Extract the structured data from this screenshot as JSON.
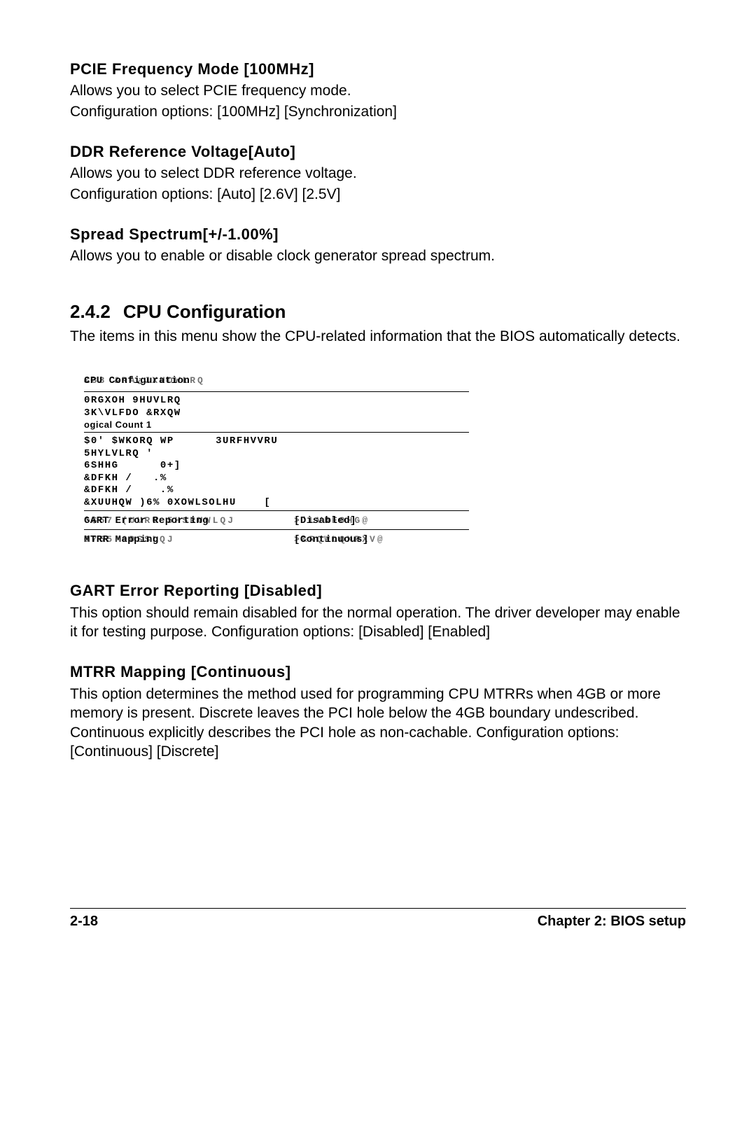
{
  "sections": [
    {
      "heading": "PCIE Frequency Mode [100MHz]",
      "lines": [
        "Allows you to select PCIE frequency mode.",
        "Configuration options: [100MHz] [Synchronization]"
      ]
    },
    {
      "heading": "DDR Reference Voltage[Auto]",
      "lines": [
        "Allows you to select DDR reference voltage.",
        "Configuration options: [Auto] [2.6V] [2.5V]"
      ]
    },
    {
      "heading": "Spread Spectrum[+/-1.00%]",
      "lines": [
        "Allows you to enable or disable clock generator spread spectrum."
      ]
    }
  ],
  "subsection": {
    "number": "2.4.2",
    "title": "CPU Configuration",
    "intro": "The items in this menu show the CPU-related information that the BIOS automatically detects."
  },
  "bios": {
    "title_clear": "CPU Configuration",
    "title_garble": "&38 &RA¿JXUDWLRQ",
    "block1": [
      "0RGXOH 9HUVLRQ",
      "3K\\VLFDO &RXQW"
    ],
    "block1_clear": "ogical Count 1",
    "block2": [
      "$0' $WKORQ WP      3URFHVVRU",
      "5HYLVLRQ '",
      "6SHHG      0+]",
      "&DFKH /   .%",
      "&DFKH /    .%",
      "&XUUHQW )6% 0XOWLSOLHU    ["
    ],
    "options": [
      {
        "label_clear": "GART Error Reporting",
        "label_garble": "*$57 (UURU 5HSRUWLQJ",
        "value_clear": "[Disabled]",
        "value_garble": ">'LVDEOHG@"
      },
      {
        "label_clear": "MTRR Mapping",
        "label_garble": "0755 0DSSLQJ",
        "value_clear": "[Continuous]",
        "value_garble": ">&RQWLQXRXV@"
      }
    ]
  },
  "post_sections": [
    {
      "heading": "GART Error Reporting [Disabled]",
      "lines": [
        "This option should remain disabled for the normal operation. The driver developer may enable it for testing purpose. Configuration options: [Disabled] [Enabled]"
      ]
    },
    {
      "heading": "MTRR Mapping [Continuous]",
      "lines": [
        "This option determines the method used for programming CPU MTRRs when 4GB or more memory is present. Discrete leaves the PCI hole below the 4GB boundary undescribed. Continuous explicitly describes the PCI hole as non-cachable. Configuration options: [Continuous] [Discrete]"
      ]
    }
  ],
  "footer": {
    "left": "2-18",
    "right": "Chapter 2: BIOS setup"
  }
}
